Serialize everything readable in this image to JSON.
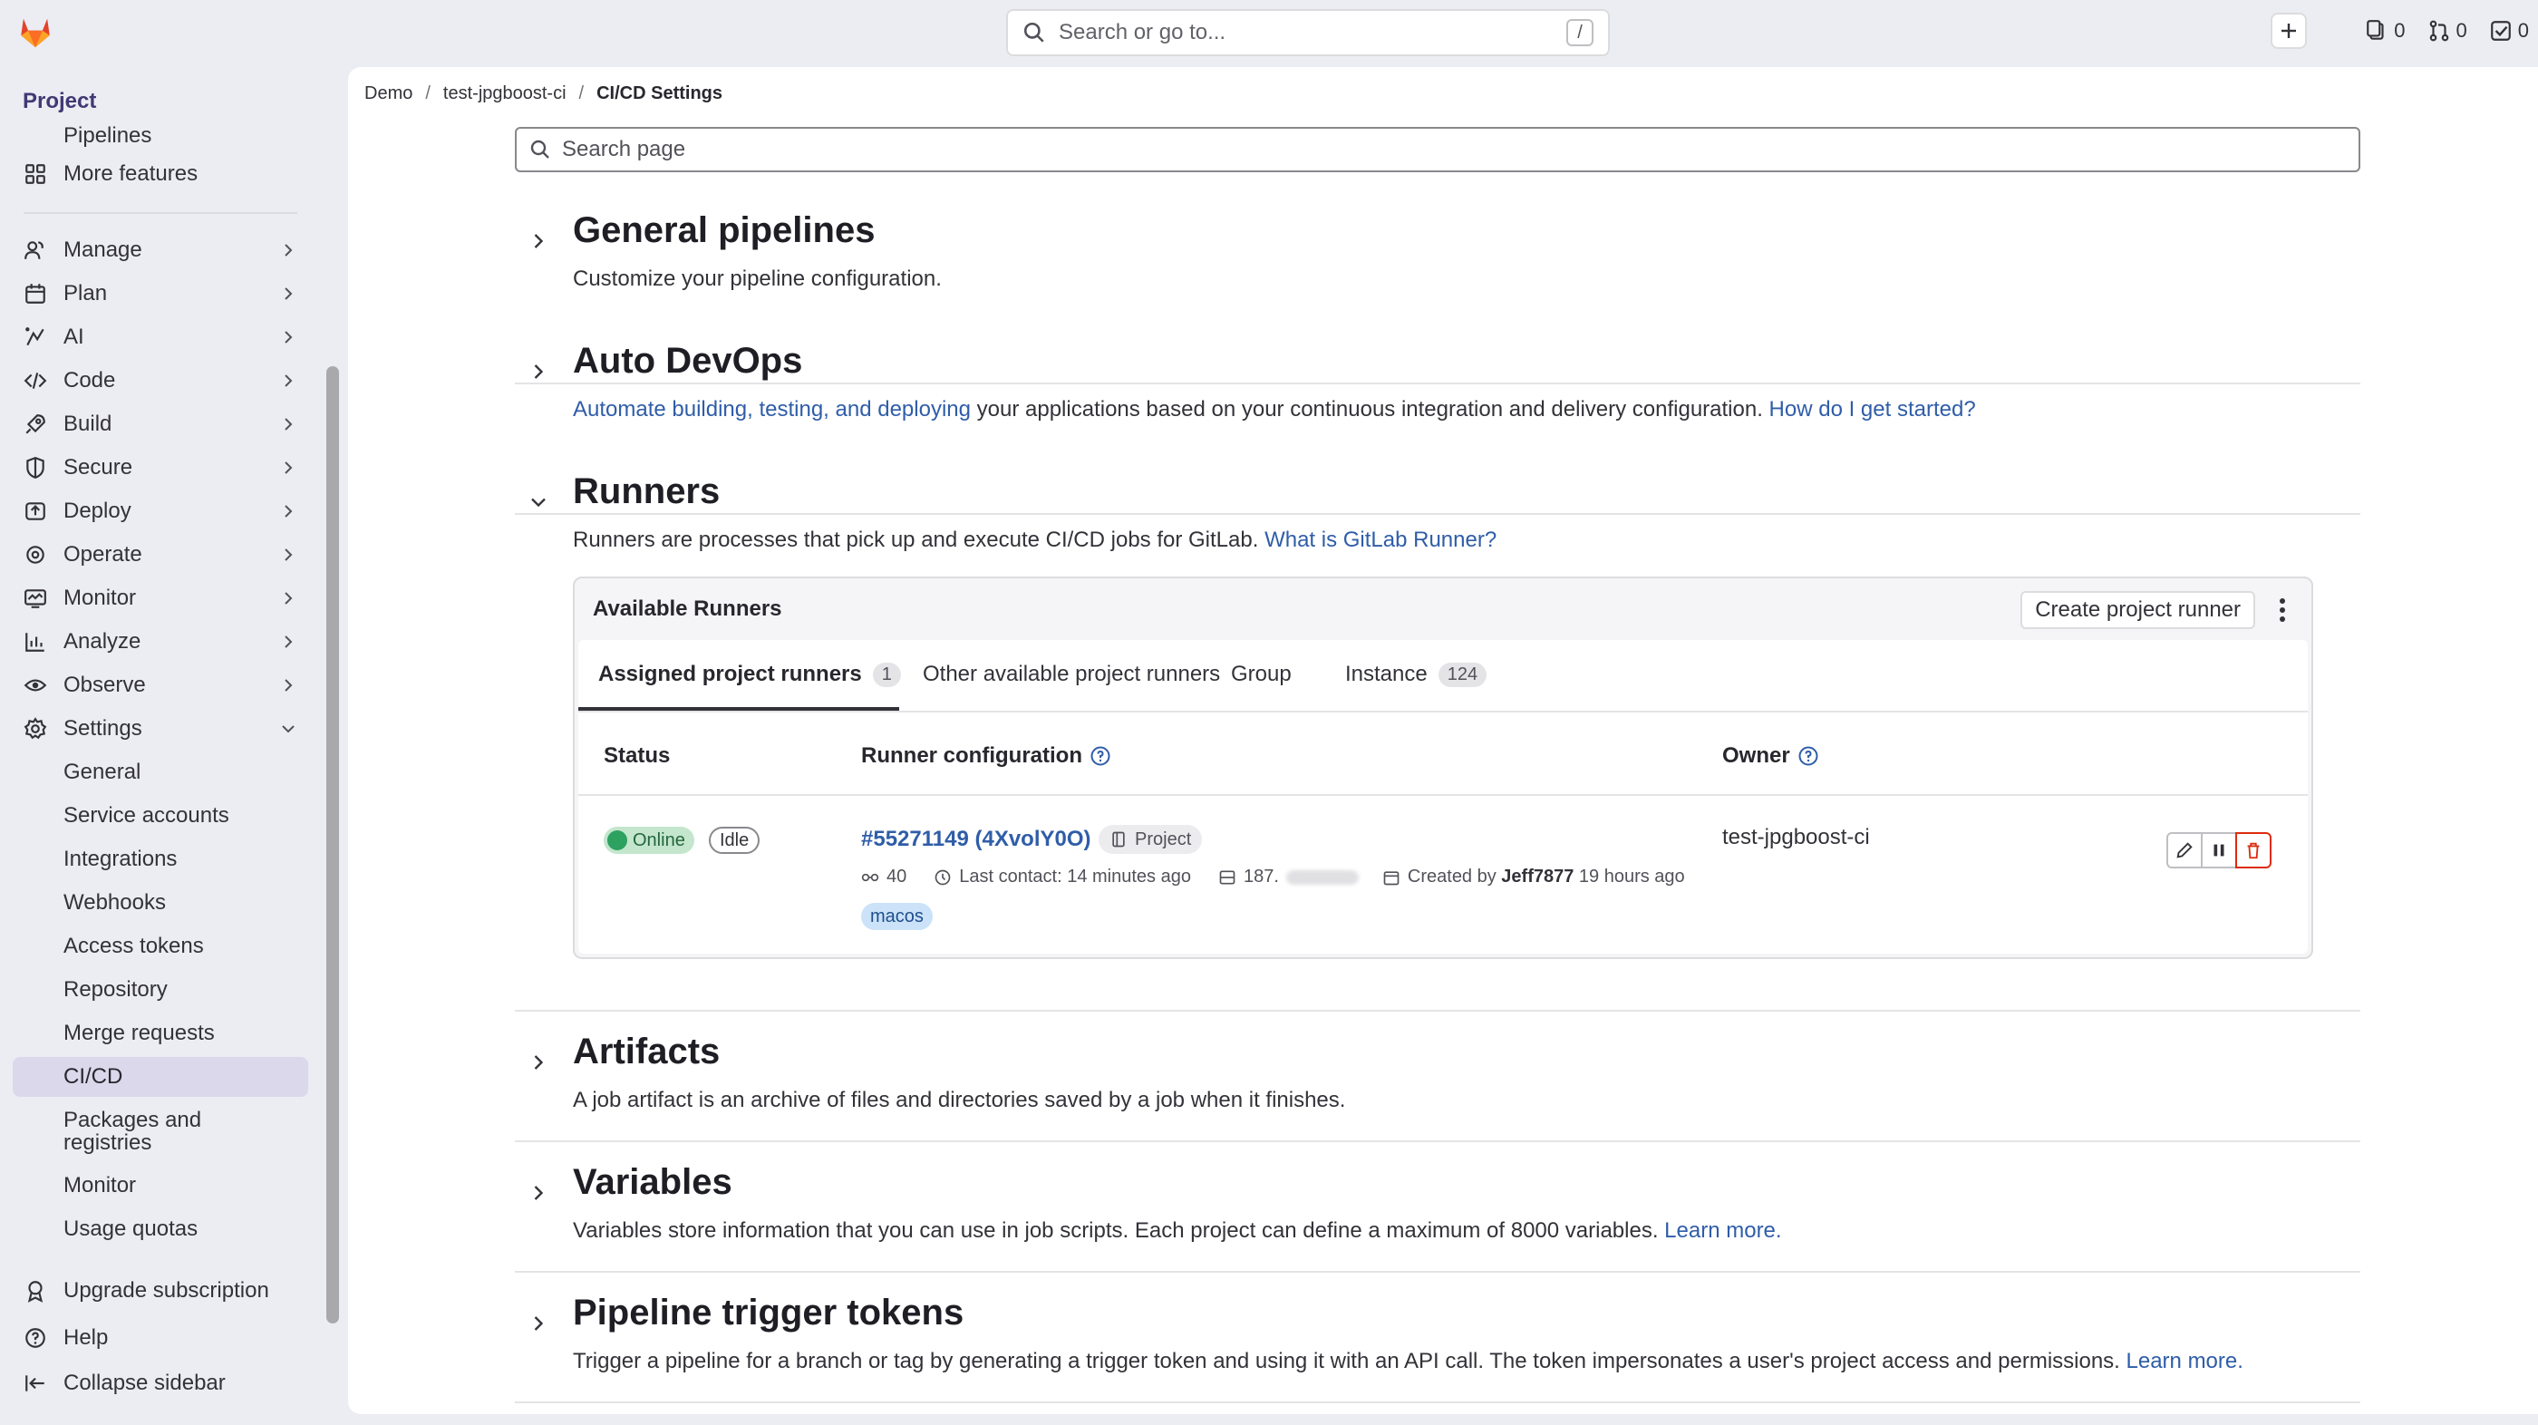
{
  "topbar": {
    "search_placeholder": "Search or go to...",
    "search_shortcut": "/",
    "issues_count": "0",
    "merge_requests_count": "0",
    "todos_count": "0"
  },
  "sidebar": {
    "project_label": "Project",
    "pipelines_label": "Pipelines",
    "more_features": "More features",
    "groups": [
      {
        "label": "Manage",
        "icon": "users-icon"
      },
      {
        "label": "Plan",
        "icon": "calendar-icon"
      },
      {
        "label": "AI",
        "icon": "ai-icon"
      },
      {
        "label": "Code",
        "icon": "code-icon"
      },
      {
        "label": "Build",
        "icon": "rocket-icon"
      },
      {
        "label": "Secure",
        "icon": "shield-icon"
      },
      {
        "label": "Deploy",
        "icon": "deploy-icon"
      },
      {
        "label": "Operate",
        "icon": "operate-icon"
      },
      {
        "label": "Monitor",
        "icon": "monitor-icon"
      },
      {
        "label": "Analyze",
        "icon": "chart-icon"
      },
      {
        "label": "Observe",
        "icon": "eye-icon"
      },
      {
        "label": "Settings",
        "icon": "gear-icon"
      }
    ],
    "settings_items": [
      "General",
      "Service accounts",
      "Integrations",
      "Webhooks",
      "Access tokens",
      "Repository",
      "Merge requests",
      "CI/CD",
      "Packages and registries",
      "Monitor",
      "Usage quotas"
    ],
    "upgrade": "Upgrade subscription",
    "help": "Help",
    "collapse": "Collapse sidebar"
  },
  "breadcrumb": {
    "items": [
      "Demo",
      "test-jpgboost-ci",
      "CI/CD Settings"
    ]
  },
  "page_search_placeholder": "Search page",
  "sections": {
    "general": {
      "title": "General pipelines",
      "desc": "Customize your pipeline configuration."
    },
    "autodevops": {
      "title": "Auto DevOps",
      "desc_link": "Automate building, testing, and deploying",
      "desc_text": " your applications based on your continuous integration and delivery configuration. ",
      "desc_link2": "How do I get started?"
    },
    "runners": {
      "title": "Runners",
      "desc_text": "Runners are processes that pick up and execute CI/CD jobs for GitLab. ",
      "desc_link": "What is GitLab Runner?"
    },
    "artifacts": {
      "title": "Artifacts",
      "desc": "A job artifact is an archive of files and directories saved by a job when it finishes."
    },
    "variables": {
      "title": "Variables",
      "desc_text": "Variables store information that you can use in job scripts. Each project can define a maximum of 8000 variables. ",
      "desc_link": "Learn more."
    },
    "triggers": {
      "title": "Pipeline trigger tokens",
      "desc_text": "Trigger a pipeline for a branch or tag by generating a trigger token and using it with an API call. The token impersonates a user's project access and permissions. ",
      "desc_link": "Learn more."
    }
  },
  "runners_card": {
    "title": "Available Runners",
    "create_button": "Create project runner",
    "tabs": [
      {
        "label": "Assigned project runners",
        "count": "1"
      },
      {
        "label": "Other available project runners",
        "count": ""
      },
      {
        "label": "Group",
        "count": ""
      },
      {
        "label": "Instance",
        "count": "124"
      }
    ],
    "columns": {
      "status": "Status",
      "config": "Runner configuration",
      "owner": "Owner"
    },
    "runner": {
      "status": "Online",
      "state": "Idle",
      "name": "#55271149 (4XvolY0O)",
      "scope": "Project",
      "jobs": "40",
      "last_contact": "Last contact: 14 minutes ago",
      "ip_prefix": "187.",
      "created_prefix": "Created by ",
      "created_by": "Jeff7877",
      "created_suffix": " 19 hours ago",
      "tag": "macos",
      "owner": "test-jpgboost-ci"
    }
  },
  "colors": {
    "accent_purple": "#3f3a74",
    "link_blue": "#2f5da8",
    "online_green": "#2da160",
    "danger_red": "#dd2b0e",
    "gitlab_orange": "#e24329"
  }
}
